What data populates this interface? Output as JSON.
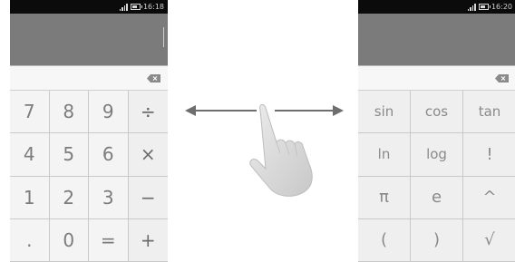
{
  "left_screen": {
    "status_time": "16:18",
    "keys": [
      "7",
      "8",
      "9",
      "÷",
      "4",
      "5",
      "6",
      "×",
      "1",
      "2",
      "3",
      "−",
      ".",
      "0",
      "=",
      "+"
    ]
  },
  "right_screen": {
    "status_time": "16:20",
    "keys": [
      "sin",
      "cos",
      "tan",
      "ln",
      "log",
      "!",
      "π",
      "e",
      "^",
      "(",
      ")",
      "√"
    ]
  },
  "icons": {
    "delete": "backspace-icon",
    "swipe_left": "arrow-left-icon",
    "swipe_right": "arrow-right-icon",
    "hand": "hand-swipe-icon"
  },
  "colors": {
    "display": "#7b7b7b",
    "status_bar": "#0b0b0b",
    "key_text": "#7c7c7c",
    "arrow": "#6e6e6e"
  }
}
